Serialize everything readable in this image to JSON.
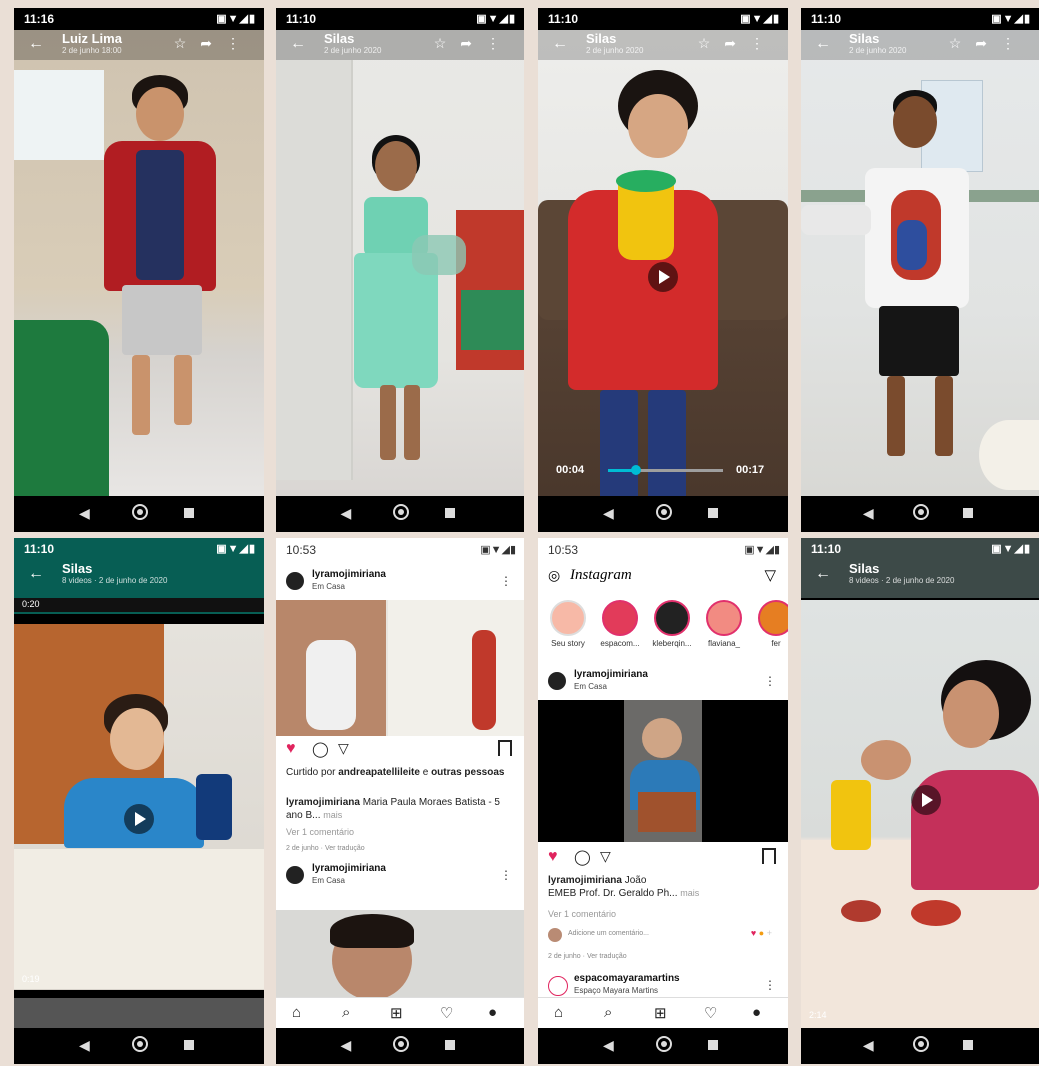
{
  "p1": {
    "time": "11:16",
    "status_icons": "▣▼◢▮",
    "title": "Luiz Lima",
    "subtitle": "2 de junho 18:00",
    "star": "☆",
    "share": "➦",
    "more": "⋮"
  },
  "p2": {
    "time": "11:10",
    "status_icons": "▣▼◢▮",
    "title": "Silas",
    "subtitle": "2 de junho 2020",
    "star": "☆",
    "share": "➦",
    "more": "⋮"
  },
  "p3": {
    "time": "11:10",
    "status_icons": "▣▼◢▮",
    "title": "Silas",
    "subtitle": "2 de junho 2020",
    "star": "☆",
    "share": "➦",
    "more": "⋮",
    "elapsed": "00:04",
    "duration": "00:17",
    "progress": 0.24
  },
  "p4": {
    "time": "11:10",
    "status_icons": "▣▼◢▮",
    "title": "Silas",
    "subtitle": "2 de junho 2020",
    "star": "☆",
    "share": "➦",
    "more": "⋮"
  },
  "p5": {
    "time": "11:10",
    "status_icons": "▣▼◢▮",
    "title": "Silas",
    "subtitle": "8 videos · 2 de junho de 2020",
    "top_time": "0:20",
    "bottom_time": "0:19"
  },
  "p6": {
    "time": "10:53",
    "status_icons": "▣▼◢▮",
    "account": "lyramojimiriana",
    "location": "Em Casa",
    "liked_prefix": "Curtido por",
    "liked_user": "andreapatellileite",
    "liked_suffix": "e",
    "liked_others": "outras pessoas",
    "caption_user": "lyramojimiriana",
    "caption_text": "Maria Paula Moraes Batista - 5 ano B...",
    "more": "mais",
    "comments": "Ver 1 comentário",
    "date": "2 de junho",
    "translate": "Ver tradução",
    "account2": "lyramojimiriana",
    "location2": "Em Casa"
  },
  "p7": {
    "time": "10:53",
    "status_icons": "▣▼◢▮",
    "logo": "Instagram",
    "stories": [
      "Seu story",
      "espacom...",
      "kleberqin...",
      "flaviana_",
      "fer"
    ],
    "account": "lyramojimiriana",
    "location": "Em Casa",
    "caption_user": "lyramojimiriana",
    "caption_name": "João",
    "caption_text": "EMEB Prof. Dr. Geraldo Ph...",
    "more": "mais",
    "comments": "Ver 1 comentário",
    "add_comment": "Adicione um comentário...",
    "date": "2 de junho",
    "translate": "Ver tradução",
    "account2": "espacomayaramartins",
    "account2_sub": "Espaço Mayara Martins"
  },
  "p8": {
    "time": "11:10",
    "status_icons": "▣▼◢▮",
    "title": "Silas",
    "subtitle": "8 videos · 2 de junho de 2020",
    "bottom_time": "2:14"
  }
}
